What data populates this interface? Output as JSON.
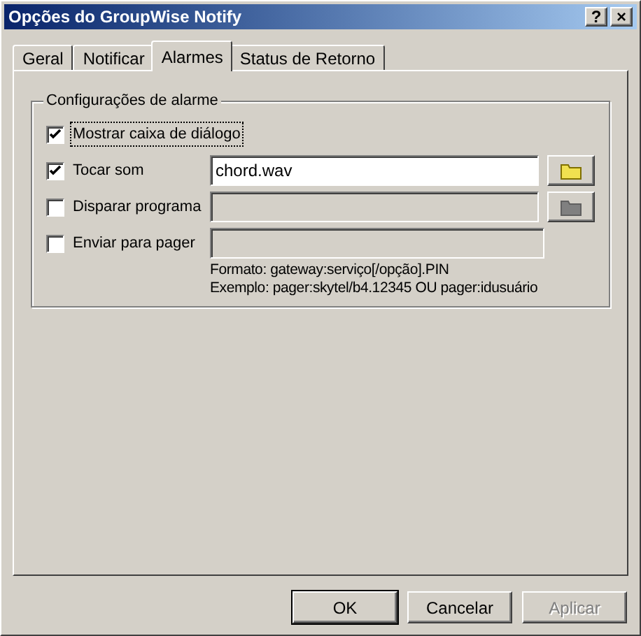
{
  "window": {
    "title": "Opções do GroupWise Notify",
    "controls": [
      "?",
      "×"
    ]
  },
  "tabs": [
    {
      "label": "Geral",
      "selected": false
    },
    {
      "label": "Notificar",
      "selected": false
    },
    {
      "label": "Alarmes",
      "selected": true
    },
    {
      "label": "Status de Retorno",
      "selected": false
    }
  ],
  "group": {
    "title": "Configurações de alarme",
    "options": [
      {
        "label": "Mostrar caixa de diálogo",
        "checked": true,
        "focused": true
      },
      {
        "label": "Tocar som",
        "checked": true,
        "focused": false,
        "field": {
          "value": "chord.wav",
          "disabled": false
        },
        "browse": {
          "disabled": false
        }
      },
      {
        "label": "Disparar programa",
        "checked": false,
        "focused": false,
        "field": {
          "disabled": true
        },
        "browse": {
          "disabled": true
        }
      },
      {
        "label": "Enviar para pager",
        "checked": false,
        "focused": false,
        "field": {
          "disabled": true
        }
      }
    ],
    "hints": [
      "Formato: gateway:serviço[/opção].PIN",
      "Exemplo: pager:skytel/b4.12345 OU pager:idusuário"
    ]
  },
  "buttons": [
    {
      "label": "OK",
      "default": true,
      "disabled": false
    },
    {
      "label": "Cancelar",
      "default": false,
      "disabled": false
    },
    {
      "label": "Aplicar",
      "default": false,
      "disabled": true
    }
  ]
}
